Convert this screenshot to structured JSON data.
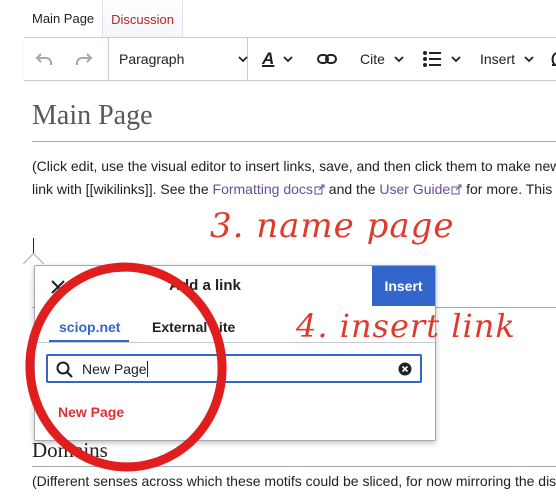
{
  "tabs": [
    {
      "label": "Main Page"
    },
    {
      "label": "Discussion"
    }
  ],
  "toolbar": {
    "undo_icon": "undo-icon",
    "redo_icon": "redo-icon",
    "paragraph_label": "Paragraph",
    "text_style_label": "A",
    "link_icon": "link-icon",
    "cite_label": "Cite",
    "list_icon": "bullet-list-icon",
    "insert_label": "Insert"
  },
  "page": {
    "title": "Main Page",
    "line1": "(Click edit, use the visual editor to insert links, save, and then click them to make new",
    "line2_a": "link with [[wikilinks]]. See the ",
    "line2_link1": "Formatting docs",
    "line2_b": " and the ",
    "line2_link2": "User Guide",
    "line2_c": " for more. This",
    "domains_heading": "Domains",
    "domains_text": "(Different senses across which these motifs could be sliced, for now mirroring the dis"
  },
  "dialog": {
    "title": "Add a link",
    "insert_label": "Insert",
    "tab_internal": "sciop.net",
    "tab_external": "External site",
    "search_value": "New Page",
    "result_label": "New Page"
  },
  "annotations": {
    "note1": "3. name page",
    "note2": "4. insert link",
    "color": "#e03a2c"
  },
  "colors": {
    "accent": "#3366cc",
    "new_link": "#dd3333",
    "visited_link": "#6b4ba1"
  }
}
